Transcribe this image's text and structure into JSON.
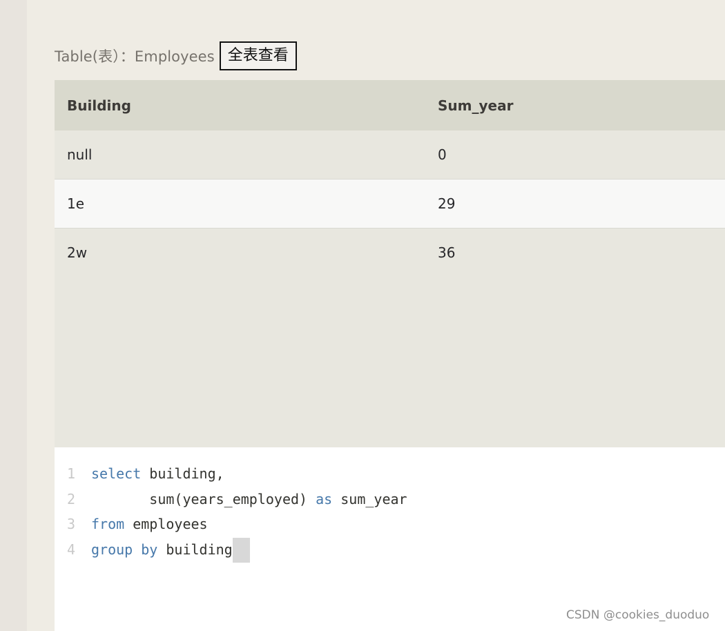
{
  "caption": {
    "label": "Table(表）：Employees",
    "view_all_label": "全表查看"
  },
  "result_table": {
    "headers": [
      "Building",
      "Sum_year"
    ],
    "rows": [
      [
        "null",
        "0"
      ],
      [
        "1e",
        "29"
      ],
      [
        "2w",
        "36"
      ]
    ]
  },
  "editor": {
    "line_numbers": [
      "1",
      "2",
      "3",
      "4"
    ],
    "lines": [
      {
        "kw1": "select",
        "text1": " building,"
      },
      {
        "indent": "       ",
        "text1": "sum(years_employed) ",
        "kw1": "as",
        "text2": " sum_year"
      },
      {
        "kw1": "from",
        "text1": " employees"
      },
      {
        "kw1": "group by",
        "text1": " building"
      }
    ]
  },
  "watermark": "CSDN @cookies_duoduo",
  "colors": {
    "keyword": "#4678aa",
    "header_bg": "#d9d9cd",
    "panel_bg": "#e8e7df",
    "page_bg": "#efece4"
  }
}
